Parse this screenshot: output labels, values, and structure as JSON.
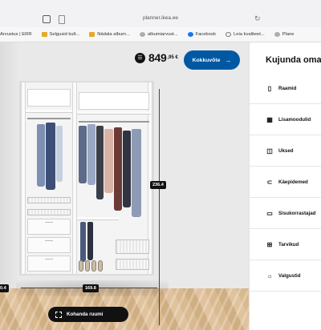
{
  "browser": {
    "url": "planner.ikea.ee",
    "bookmarks": [
      {
        "label": "Arvustus | ERR",
        "icon": "none"
      },
      {
        "label": "Selgusid kult...",
        "icon": "folder"
      },
      {
        "label": "Nädala album...",
        "icon": "folder"
      },
      {
        "label": "albumiarvust...",
        "icon": "grey"
      },
      {
        "label": "Facebook",
        "icon": "fb"
      },
      {
        "label": "Leia kvaliteet...",
        "icon": "globe"
      },
      {
        "label": "Plane",
        "icon": "grey"
      }
    ]
  },
  "planner": {
    "price_main": "849",
    "price_cents": ",95 €",
    "summary_button": "Kokkuvõte",
    "adjust_room_button": "Kohanda ruumi",
    "dimensions": {
      "height": "236.4",
      "width": "169.8",
      "depth": "60.4"
    }
  },
  "panel": {
    "title": "Kujunda oma",
    "items": [
      {
        "label": "Raamid",
        "icon": "frame-icon"
      },
      {
        "label": "Lisamoodulid",
        "icon": "modules-icon"
      },
      {
        "label": "Uksed",
        "icon": "door-icon"
      },
      {
        "label": "Käepidemed",
        "icon": "handle-icon"
      },
      {
        "label": "Sisukorrastajad",
        "icon": "organizer-icon"
      },
      {
        "label": "Tarvikud",
        "icon": "accessories-icon"
      },
      {
        "label": "Valgustid",
        "icon": "light-icon"
      }
    ]
  },
  "colors": {
    "primary_button": "#0058a3",
    "dark_button": "#111111"
  }
}
